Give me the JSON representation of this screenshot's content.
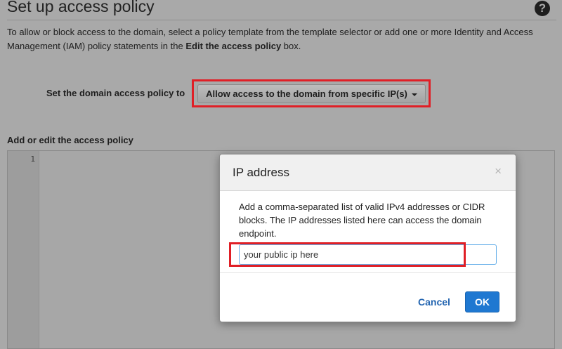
{
  "page": {
    "title": "Set up access policy",
    "help_glyph": "?",
    "description_prefix": "To allow or block access to the domain, select a policy template from the template selector or add one or more Identity and Access Management (IAM) policy statements in the ",
    "description_bold": "Edit the access policy",
    "description_suffix": " box."
  },
  "policy": {
    "label": "Set the domain access policy to",
    "selected": "Allow access to the domain from specific IP(s)"
  },
  "editor": {
    "label": "Add or edit the access policy",
    "line_numbers": [
      "1"
    ]
  },
  "modal": {
    "title": "IP address",
    "close_glyph": "×",
    "description": "Add a comma-separated list of valid IPv4 addresses or CIDR blocks. The IP addresses listed here can access the domain endpoint.",
    "input_placeholder": "your public ip here",
    "cancel_label": "Cancel",
    "ok_label": "OK"
  },
  "colors": {
    "highlight": "#e01f26",
    "primary_button": "#1f78d1",
    "link": "#2264b0"
  }
}
